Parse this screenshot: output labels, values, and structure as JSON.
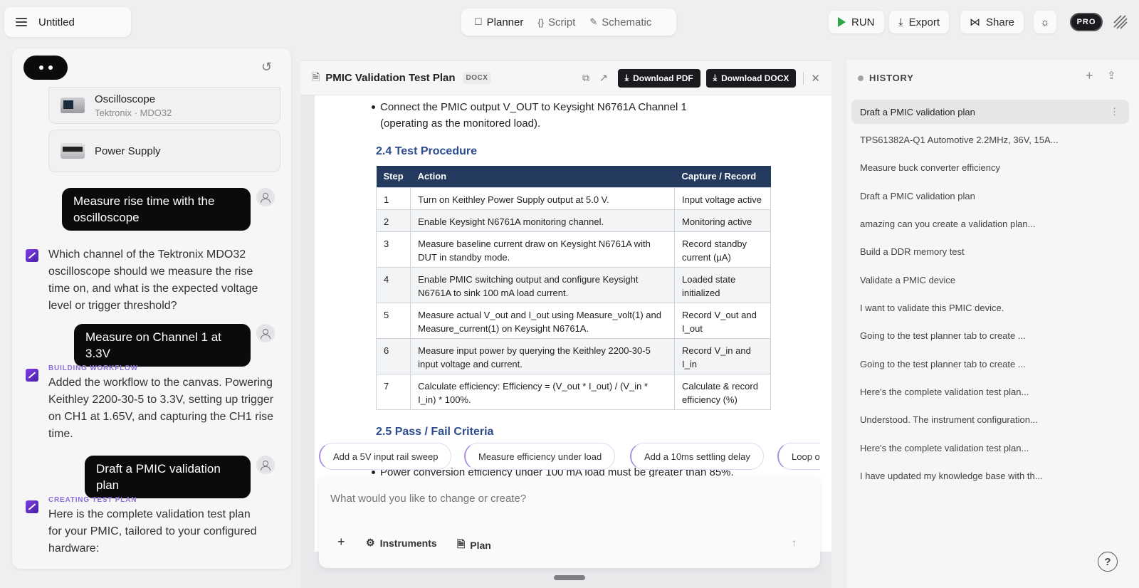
{
  "header": {
    "doc_title": "Untitled",
    "modes": [
      "Planner",
      "Script",
      "Schematic"
    ],
    "run_label": "RUN",
    "export_label": "Export",
    "share_label": "Share",
    "pro_label": "PRO",
    "run_color": "#2ba84a"
  },
  "chat": {
    "instruments": [
      {
        "name": "Oscilloscope",
        "sub": "Tektronix · MDO32"
      },
      {
        "name": "Power Supply",
        "sub": ""
      }
    ],
    "messages": {
      "u1": "Measure rise time with the oscilloscope",
      "b1": "Which channel of the Tektronix MDO32 oscilloscope should we measure the rise time on, and what is the expected voltage level or trigger threshold?",
      "u2": "Measure on Channel 1 at 3.3V",
      "b2_tag": "BUILDING WORKFLOW",
      "b2": "Added the workflow to the canvas. Powering Keithley 2200-30-5 to 3.3V, setting up trigger on CH1 at 1.65V, and capturing the CH1 rise time.",
      "u3": "Draft a PMIC validation plan",
      "b3_tag": "CREATING TEST PLAN",
      "b3": "Here is the complete validation test plan for your PMIC, tailored to your configured hardware:"
    }
  },
  "document": {
    "title": "PMIC Validation Test Plan",
    "format": "DOCX",
    "download_pdf": "Download PDF",
    "download_docx": "Download DOCX",
    "bullet_top": "Connect the PMIC output V_OUT to Keysight N6761A Channel 1 (operating as the monitored load).",
    "section_procedure": "2.4 Test Procedure",
    "table_headers": [
      "Step",
      "Action",
      "Capture / Record"
    ],
    "table_rows": [
      [
        "1",
        "Turn on Keithley Power Supply output at 5.0 V.",
        "Input voltage active"
      ],
      [
        "2",
        "Enable Keysight N6761A monitoring channel.",
        "Monitoring active"
      ],
      [
        "3",
        "Measure baseline current draw on Keysight N6761A with DUT in standby mode.",
        "Record standby current (µA)"
      ],
      [
        "4",
        "Enable PMIC switching output and configure Keysight N6761A to sink 100 mA load current.",
        "Loaded state initialized"
      ],
      [
        "5",
        "Measure actual V_out and I_out using Measure_volt(1) and Measure_current(1) on Keysight N6761A.",
        "Record V_out and I_out"
      ],
      [
        "6",
        "Measure input power by querying the Keithley 2200-30-5 input voltage and current.",
        "Record V_in and I_in"
      ],
      [
        "7",
        "Calculate efficiency: Efficiency = (V_out * I_out) / (V_in * I_in) * 100%.",
        "Calculate & record efficiency (%)"
      ]
    ],
    "section_pass": "2.5 Pass / Fail Criteria",
    "bullet_partial": "Power conversion efficiency under 100 mA load must be greater than 85%."
  },
  "suggestions": [
    "Add a 5V input rail sweep",
    "Measure efficiency under load",
    "Add a 10ms settling delay",
    "Loop ov"
  ],
  "composer": {
    "placeholder": "What would you like to change or create?",
    "instruments_label": "Instruments",
    "plan_label": "Plan"
  },
  "history": {
    "title": "HISTORY",
    "items": [
      "Draft a PMIC validation plan",
      "TPS61382A-Q1 Automotive 2.2MHz, 36V, 15A...",
      "Measure buck converter efficiency",
      "Draft a PMIC validation plan",
      "amazing can you create a validation plan...",
      "Build a DDR memory test",
      "Validate a PMIC device",
      "I want to validate this PMIC device.",
      "Going to the test planner tab to create ...",
      "Going to the test planner tab to create ...",
      "Here's the complete validation test plan...",
      "Understood. The instrument configuration...",
      "Here's the complete validation test plan...",
      "I have updated my knowledge base with th..."
    ]
  }
}
